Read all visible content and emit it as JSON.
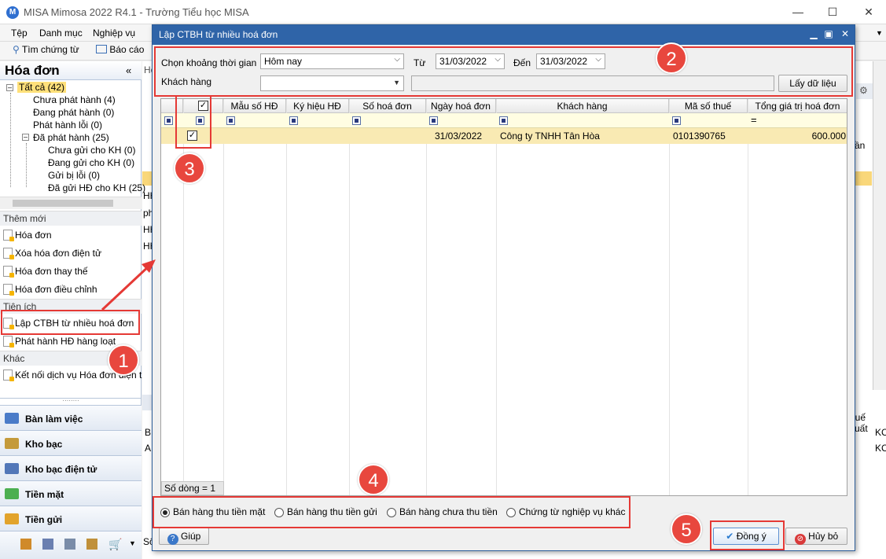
{
  "window": {
    "title": "MISA Mimosa 2022 R4.1 - Trường Tiểu học MISA"
  },
  "menu": [
    "Tệp",
    "Danh mục",
    "Nghiệp vụ"
  ],
  "toolbar": {
    "find": "Tìm chứng từ",
    "report": "Báo cáo"
  },
  "left_panel": {
    "title": "Hóa đơn",
    "tree": [
      "Tất cả (42)",
      "Chưa phát hành (4)",
      "Đang phát hành (0)",
      "Phát hành lỗi (0)",
      "Đã phát hành (25)",
      "Chưa gửi cho KH (0)",
      "Đang gửi cho KH (0)",
      "Gửi bị lỗi (0)",
      "Đã gửi HĐ cho KH (25)"
    ],
    "sections": {
      "new": "Thêm mới",
      "util": "Tiện ích",
      "other": "Khác"
    },
    "new_items": [
      "Hóa đơn",
      "Xóa hóa đơn điện tử",
      "Hóa đơn thay thế",
      "Hóa đơn điều chỉnh"
    ],
    "util_items": [
      "Lập CTBH từ nhiều hoá đơn",
      "Phát hành HĐ hàng loạt"
    ],
    "other_items": [
      "Kết nối dịch vụ Hóa đơn điện t"
    ],
    "nav": [
      "Bàn làm việc",
      "Kho bạc",
      "Kho bạc điện tử",
      "Tiền mặt",
      "Tiền gửi"
    ]
  },
  "background_fragments": {
    "hoa": "Hóa",
    "hh1": "HH",
    "hh2": "HH",
    "ph": "ph",
    "hh3": "HH",
    "hh4": "HH",
    "tan": "ần",
    "b": "B",
    "a": "A",
    "thue": "huế suất",
    "ko1": "KC",
    "ko2": "KC",
    "so": "Sổ"
  },
  "dialog": {
    "title": "Lập CTBH từ nhiều hoá đơn",
    "period_label": "Chọn khoảng thời gian",
    "period_value": "Hôm nay",
    "from_label": "Từ",
    "from_value": "31/03/2022",
    "to_label": "Đến",
    "to_value": "31/03/2022",
    "customer_label": "Khách hàng",
    "customer_value": "",
    "fetch_button": "Lấy dữ liệu",
    "columns": [
      "Mẫu số HĐ",
      "Ký hiệu HĐ",
      "Số hoá đơn",
      "Ngày hoá đơn",
      "Khách hàng",
      "Mã số thuế",
      "Tổng giá trị hoá đơn"
    ],
    "filter_eq": "=",
    "rows": [
      {
        "checked": true,
        "mau_so": "",
        "ky_hieu": "",
        "so_hd": "",
        "ngay": "31/03/2022",
        "khach_hang": "Công ty TNHH Tân Hòa",
        "mst": "0101390765",
        "tong": "600.000"
      }
    ],
    "row_count": "Số dòng = 1",
    "options": [
      "Bán hàng thu tiền mặt",
      "Bán hàng thu tiền gửi",
      "Bán hàng chưa thu tiền",
      "Chứng từ nghiệp vụ khác"
    ],
    "selected_option": 0,
    "help_button": "Giúp",
    "ok_button": "Đồng ý",
    "cancel_button": "Hủy bỏ"
  },
  "badges": [
    "1",
    "2",
    "3",
    "4",
    "5"
  ],
  "colors": {
    "dialog_title": "#2f64a8",
    "highlight": "#f9eab3",
    "annotation": "#e53935"
  }
}
